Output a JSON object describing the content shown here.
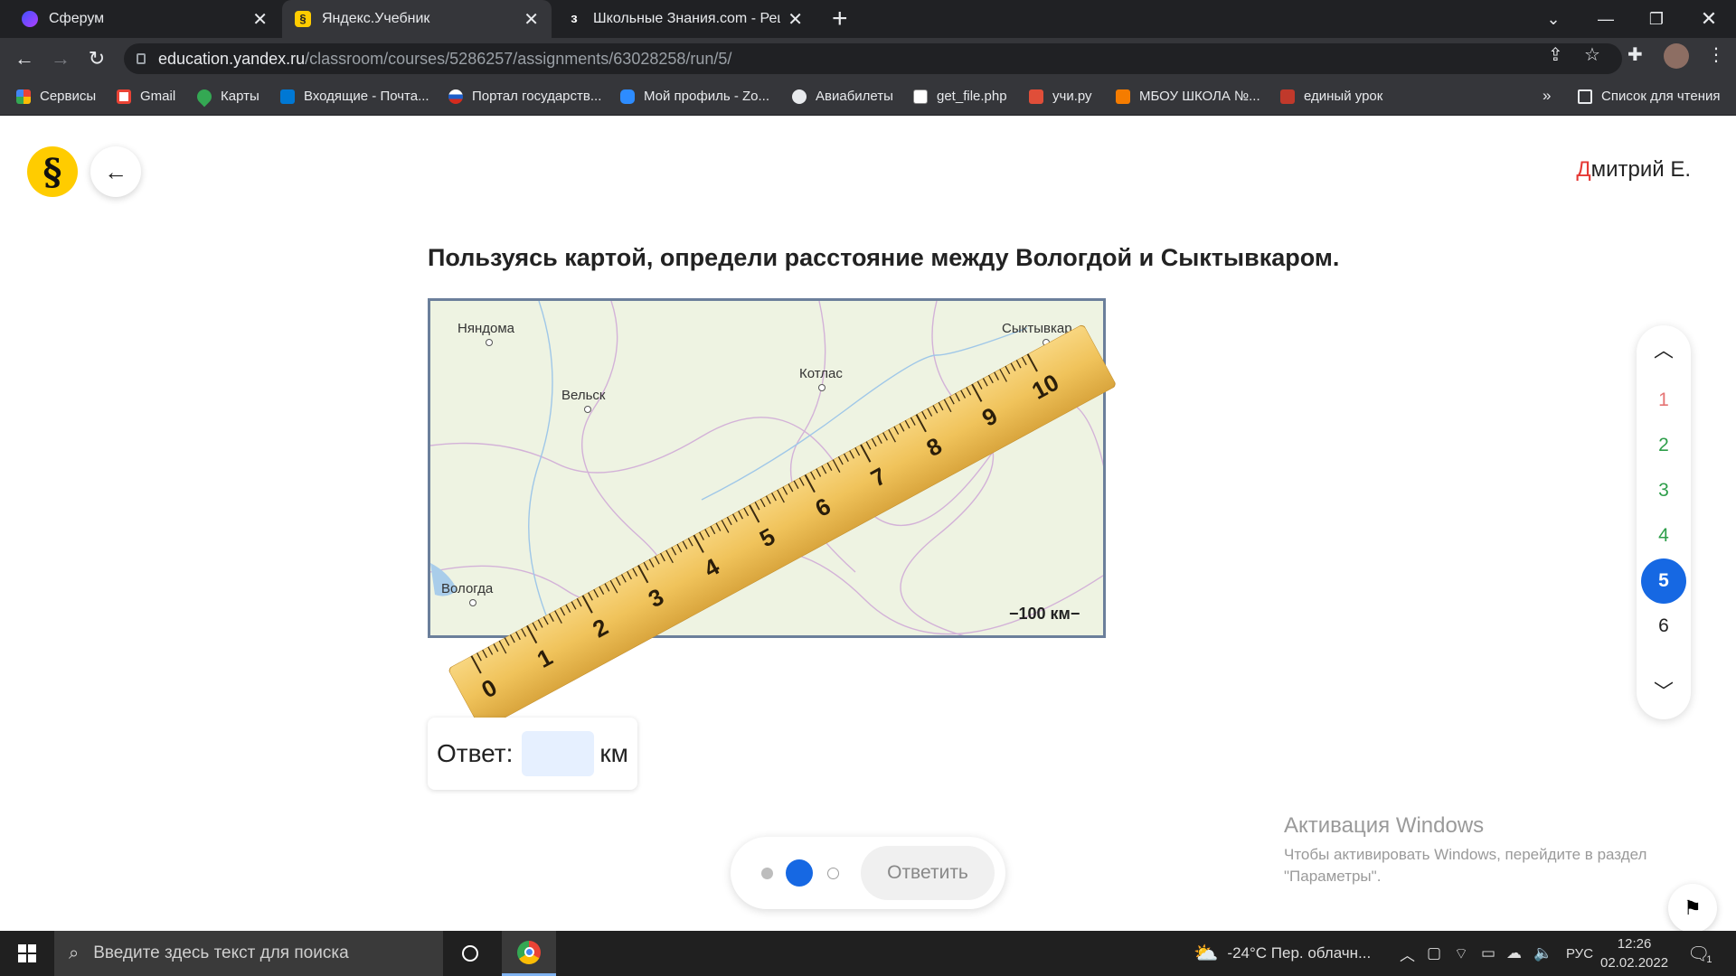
{
  "browser": {
    "tabs": [
      {
        "title": "Сферум",
        "favicon_color": "#7b3ff2"
      },
      {
        "title": "Яндекс.Учебник",
        "favicon_color": "#ffcc00"
      },
      {
        "title": "Школьные Знания.com - Решае",
        "favicon_color": "#202124"
      }
    ],
    "url_host": "education.yandex.ru",
    "url_path": "/classroom/courses/5286257/assignments/63028258/run/5/",
    "bookmarks": [
      {
        "label": "Сервисы",
        "color": "#ea4335"
      },
      {
        "label": "Gmail",
        "color": "#ea4335"
      },
      {
        "label": "Карты",
        "color": "#34a853"
      },
      {
        "label": "Входящие - Почта...",
        "color": "#0078d4"
      },
      {
        "label": "Портал государств...",
        "color": "#d52b1e"
      },
      {
        "label": "Мой профиль - Zo...",
        "color": "#2d8cff"
      },
      {
        "label": "Авиабилеты",
        "color": "#e8eaed"
      },
      {
        "label": "get_file.php",
        "color": "#e8eaed"
      },
      {
        "label": "учи.ру",
        "color": "#e04e39"
      },
      {
        "label": "МБОУ ШКОЛА №...",
        "color": "#f57c00"
      },
      {
        "label": "единый урок",
        "color": "#c0392b"
      }
    ],
    "reading_list": "Список для чтения",
    "more_bookmarks": "»"
  },
  "page": {
    "logo_glyph": "§",
    "user_first_letter": "Д",
    "user_rest": "митрий Е.",
    "question": "Пользуясь картой, определи расстояние между Вологдой и Сыктывкаром.",
    "map": {
      "cities": [
        {
          "name": "Няндома"
        },
        {
          "name": "Вельск"
        },
        {
          "name": "Котлас"
        },
        {
          "name": "Сыктывкар"
        },
        {
          "name": "Вологда"
        }
      ],
      "scale_label": "100 км"
    },
    "ruler": {
      "marks": [
        "0",
        "1",
        "2",
        "3",
        "4",
        "5",
        "6",
        "7",
        "8",
        "9",
        "10"
      ]
    },
    "answer": {
      "label": "Ответ:",
      "value": "",
      "unit": "км"
    },
    "submit_label": "Ответить",
    "side_nav": {
      "items": [
        {
          "label": "1",
          "status": "wrong",
          "color": "#e57373"
        },
        {
          "label": "2",
          "status": "correct",
          "color": "#2e9e4a"
        },
        {
          "label": "3",
          "status": "correct",
          "color": "#2e9e4a"
        },
        {
          "label": "4",
          "status": "correct",
          "color": "#2e9e4a"
        },
        {
          "label": "5",
          "status": "current",
          "color": "#ffffff"
        },
        {
          "label": "6",
          "status": "pending",
          "color": "#222222"
        }
      ]
    },
    "windows_activation": {
      "title": "Активация Windows",
      "line1": "Чтобы активировать Windows, перейдите в раздел",
      "line2": "\"Параметры\"."
    }
  },
  "taskbar": {
    "search_placeholder": "Введите здесь текст для поиска",
    "weather": "-24°C  Пер. облачн...",
    "language": "РУС",
    "time": "12:26",
    "date": "02.02.2022",
    "notifications": "1"
  }
}
